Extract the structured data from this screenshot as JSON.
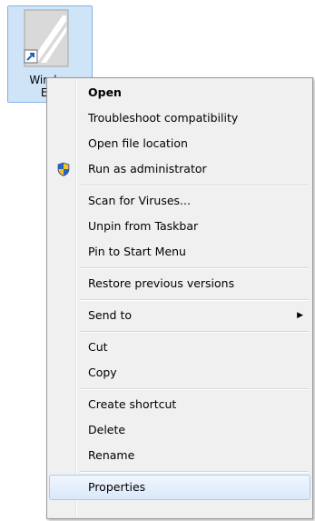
{
  "desktop_icon": {
    "label_line1": "Window",
    "label_line2": "Exp"
  },
  "context_menu": {
    "groups": [
      [
        {
          "label": "Open",
          "bold": true
        },
        {
          "label": "Troubleshoot compatibility"
        },
        {
          "label": "Open file location"
        },
        {
          "label": "Run as administrator",
          "icon": "uac-shield-icon"
        }
      ],
      [
        {
          "label": "Scan for Viruses..."
        },
        {
          "label": "Unpin from Taskbar"
        },
        {
          "label": "Pin to Start Menu"
        }
      ],
      [
        {
          "label": "Restore previous versions"
        }
      ],
      [
        {
          "label": "Send to",
          "submenu": true
        }
      ],
      [
        {
          "label": "Cut"
        },
        {
          "label": "Copy"
        }
      ],
      [
        {
          "label": "Create shortcut"
        },
        {
          "label": "Delete"
        },
        {
          "label": "Rename"
        }
      ],
      [
        {
          "label": "Properties",
          "highlighted": true
        }
      ]
    ]
  },
  "colors": {
    "menu_background": "#f0f0f0",
    "icon_selection": "#cfe4f7",
    "highlight_border": "#a8cbf5"
  }
}
